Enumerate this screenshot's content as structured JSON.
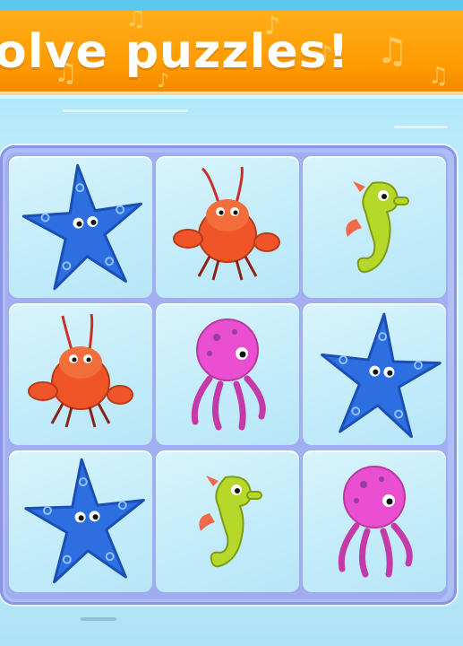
{
  "banner": {
    "title": "olve puzzles!"
  },
  "colors": {
    "banner_orange": "#ff9a00",
    "sky_blue": "#8fdcf5",
    "board_lavender": "#8c93e8",
    "tile_blue": "#c3ecfa",
    "starfish_blue": "#2d6fe0",
    "lobster_red": "#f0552a",
    "seahorse_green": "#b6d82a",
    "octopus_pink": "#e94fd0"
  },
  "board": {
    "rows": 3,
    "cols": 3,
    "tiles": [
      {
        "row": 1,
        "col": 1,
        "creature": "starfish-icon"
      },
      {
        "row": 1,
        "col": 2,
        "creature": "lobster-icon"
      },
      {
        "row": 1,
        "col": 3,
        "creature": "seahorse-icon"
      },
      {
        "row": 2,
        "col": 1,
        "creature": "lobster-icon"
      },
      {
        "row": 2,
        "col": 2,
        "creature": "octopus-icon"
      },
      {
        "row": 2,
        "col": 3,
        "creature": "starfish-icon"
      },
      {
        "row": 3,
        "col": 1,
        "creature": "starfish-icon"
      },
      {
        "row": 3,
        "col": 2,
        "creature": "seahorse-icon"
      },
      {
        "row": 3,
        "col": 3,
        "creature": "octopus-icon"
      }
    ]
  }
}
